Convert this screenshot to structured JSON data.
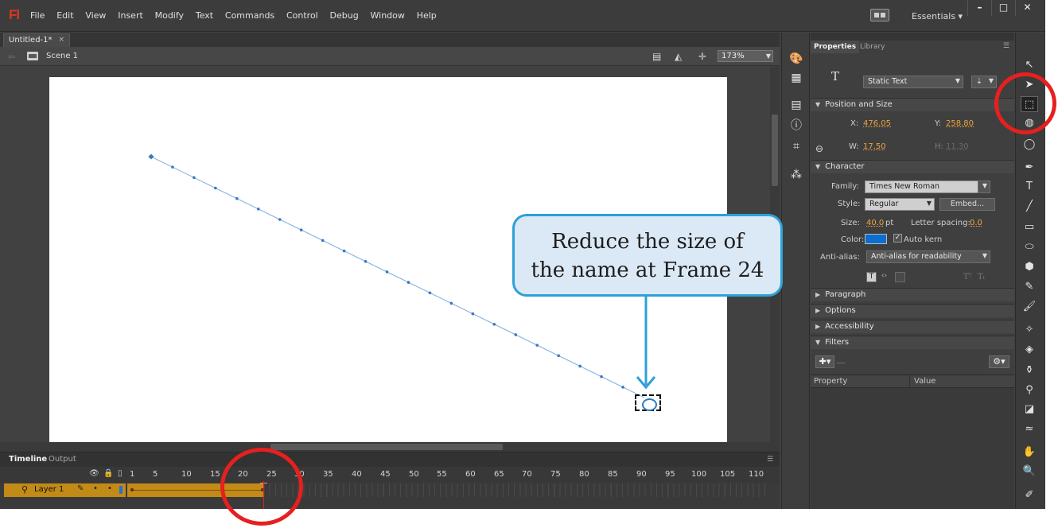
{
  "app": {
    "logo": "Fl",
    "workspace": "Essentials"
  },
  "menu": [
    "File",
    "Edit",
    "View",
    "Insert",
    "Modify",
    "Text",
    "Commands",
    "Control",
    "Debug",
    "Window",
    "Help"
  ],
  "window_controls": {
    "minimize": "–",
    "maximize": "□",
    "close": "✕"
  },
  "document": {
    "tab_label": "Untitled-1*",
    "close_glyph": "×",
    "scene": "Scene 1",
    "zoom": "173%"
  },
  "callout": {
    "line1": "Reduce the size of",
    "line2": "the name at Frame 24"
  },
  "timeline": {
    "tabs": [
      "Timeline",
      "Output"
    ],
    "frame_numbers": [
      "1",
      "5",
      "10",
      "15",
      "20",
      "25",
      "30",
      "35",
      "40",
      "45",
      "50",
      "55",
      "60",
      "65",
      "70",
      "75",
      "80",
      "85",
      "90",
      "95",
      "100",
      "105",
      "110"
    ],
    "current_frame": 24,
    "layer_name": "Layer 1",
    "tween_start_frame": 1,
    "tween_end_frame": 24
  },
  "properties": {
    "tabs": [
      "Properties",
      "Library"
    ],
    "text_type": "Static Text",
    "position_size": {
      "header": "Position and Size",
      "x_label": "X:",
      "x": "476.05",
      "y_label": "Y:",
      "y": "258.80",
      "w_label": "W:",
      "w": "17.50",
      "h_label": "H:",
      "h": "11.30"
    },
    "character": {
      "header": "Character",
      "family_label": "Family:",
      "family": "Times New Roman",
      "style_label": "Style:",
      "style": "Regular",
      "embed_button": "Embed...",
      "size_label": "Size:",
      "size": "40.0",
      "size_unit": "pt",
      "letter_spacing_label": "Letter spacing:",
      "letter_spacing": "0.0",
      "color_label": "Color:",
      "color": "#0a6fd0",
      "auto_kern_label": "Auto kern",
      "auto_kern": true,
      "anti_alias_label": "Anti-alias:",
      "anti_alias": "Anti-alias for readability"
    },
    "sections": [
      "Paragraph",
      "Options",
      "Accessibility",
      "Filters"
    ],
    "filters": {
      "columns": [
        "Property",
        "Value"
      ]
    }
  },
  "colors": {
    "accent_value": "#f0a33a",
    "annotation_red": "#e6201f",
    "callout_border": "#2ea0d8",
    "tween": "#c28a16"
  },
  "dock_icons": [
    "color-icon",
    "swatches-icon",
    "align-icon",
    "info-icon",
    "transform-icon",
    "components-icon"
  ],
  "tools": [
    "selection-tool-icon",
    "subselection-tool-icon",
    "free-transform-tool-icon",
    "3d-rotation-tool-icon",
    "lasso-tool-icon",
    "pen-tool-icon",
    "text-tool-icon",
    "line-tool-icon",
    "rectangle-tool-icon",
    "oval-tool-icon",
    "polystar-tool-icon",
    "pencil-tool-icon",
    "brush-tool-icon",
    "bone-tool-icon",
    "paint-bucket-tool-icon",
    "ink-bottle-tool-icon",
    "eyedropper-tool-icon",
    "eraser-tool-icon",
    "width-tool-icon",
    "hand-tool-icon",
    "zoom-tool-icon",
    "stroke-color-icon"
  ]
}
